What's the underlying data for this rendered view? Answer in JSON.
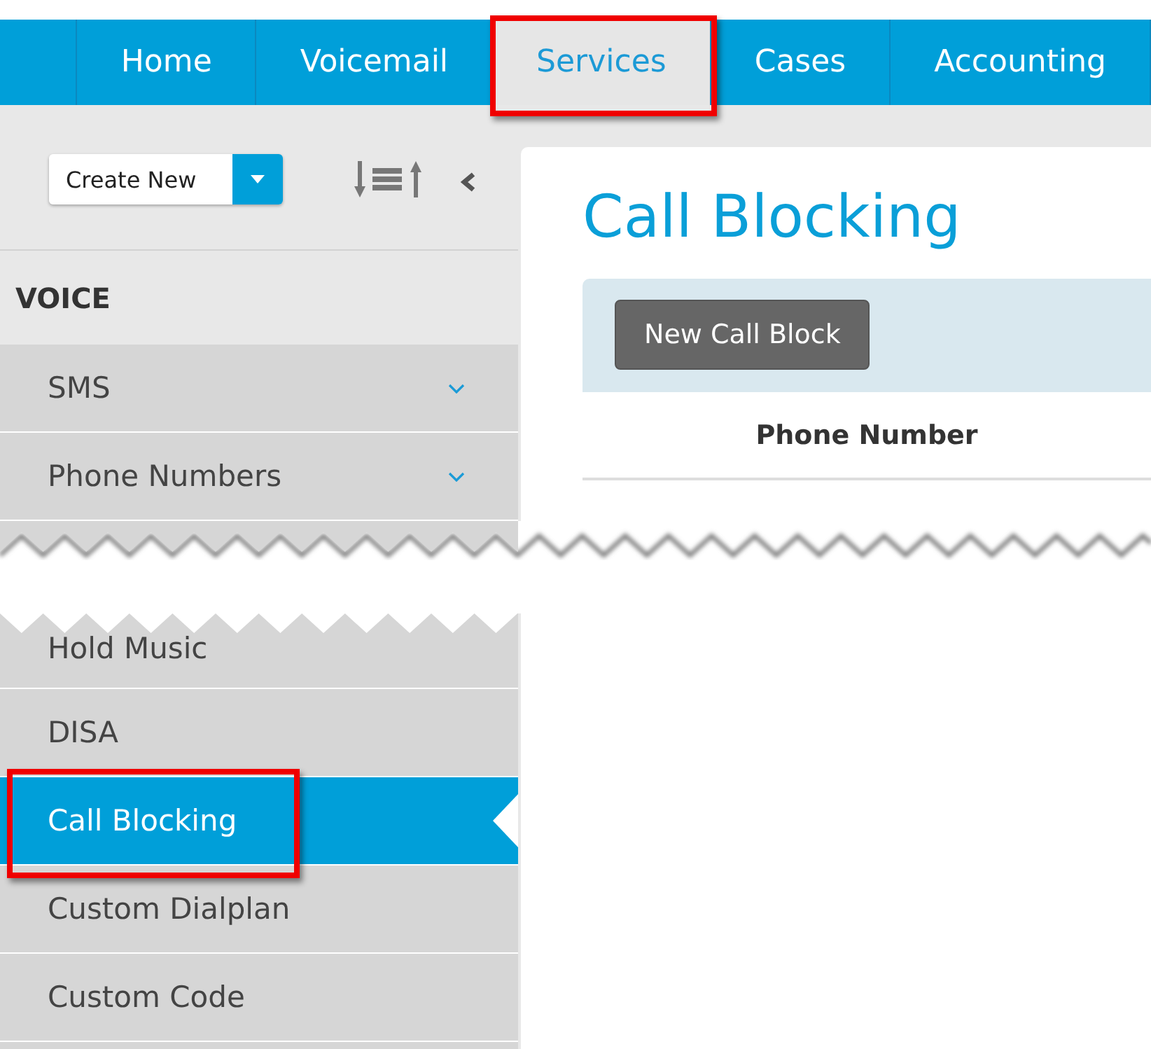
{
  "nav": {
    "items": [
      {
        "label": "Home",
        "selected": false,
        "highlighted": false
      },
      {
        "label": "Voicemail",
        "selected": false,
        "highlighted": false
      },
      {
        "label": "Services",
        "selected": true,
        "highlighted": true
      },
      {
        "label": "Cases",
        "selected": false,
        "highlighted": false
      },
      {
        "label": "Accounting",
        "selected": false,
        "highlighted": false
      }
    ]
  },
  "sidebar": {
    "create_button": "Create New",
    "section": "VOICE",
    "items": [
      {
        "label": "SMS",
        "has_submenu": true,
        "selected": false,
        "highlighted": false
      },
      {
        "label": "Phone Numbers",
        "has_submenu": true,
        "selected": false,
        "highlighted": false
      }
    ],
    "items_after_cut": [
      {
        "label": "Hold Music",
        "has_submenu": false,
        "selected": false,
        "highlighted": false
      },
      {
        "label": "DISA",
        "has_submenu": false,
        "selected": false,
        "highlighted": false
      },
      {
        "label": "Call Blocking",
        "has_submenu": false,
        "selected": true,
        "highlighted": true
      },
      {
        "label": "Custom Dialplan",
        "has_submenu": false,
        "selected": false,
        "highlighted": false
      },
      {
        "label": "Custom Code",
        "has_submenu": false,
        "selected": false,
        "highlighted": false
      }
    ]
  },
  "main": {
    "title": "Call Blocking",
    "toolbar_buttons": [
      "New Call Block"
    ],
    "table": {
      "columns": [
        "Phone Number"
      ]
    }
  }
}
